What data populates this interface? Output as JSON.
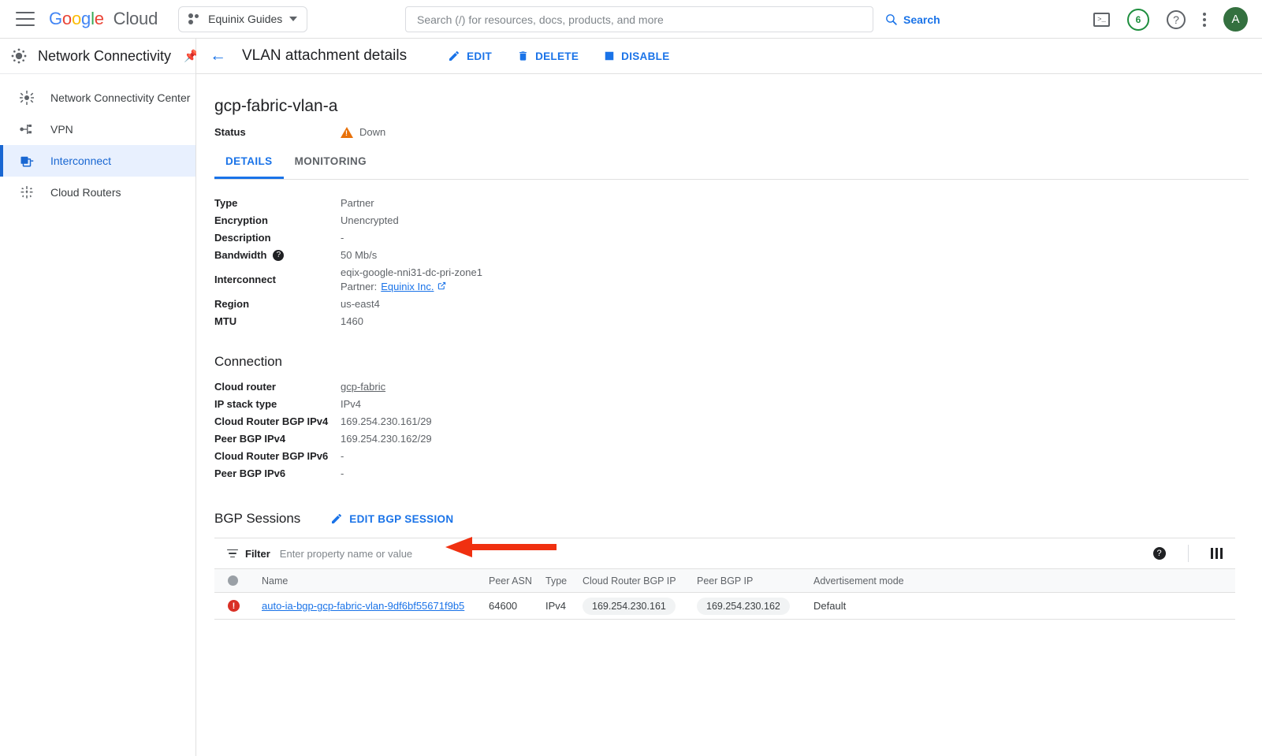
{
  "topbar": {
    "brand": "Google Cloud",
    "project_name": "Equinix Guides",
    "search_placeholder": "Search (/) for resources, docs, products, and more",
    "search_value": "",
    "search_button": "Search",
    "notification_count": "6",
    "avatar_initial": "A",
    "icons": {
      "menu": "hamburger-icon",
      "terminal": ">_",
      "help": "?",
      "kebab": "more-options-icon"
    }
  },
  "sidebar": {
    "title": "Network Connectivity",
    "items": [
      {
        "label": "Network Connectivity Center",
        "icon": "hub-icon",
        "active": false
      },
      {
        "label": "VPN",
        "icon": "vpn-icon",
        "active": false
      },
      {
        "label": "Interconnect",
        "icon": "interconnect-icon",
        "active": true
      },
      {
        "label": "Cloud Routers",
        "icon": "router-icon",
        "active": false
      }
    ]
  },
  "page": {
    "title": "VLAN attachment details",
    "actions": [
      {
        "label": "EDIT",
        "icon": "pencil-icon"
      },
      {
        "label": "DELETE",
        "icon": "trash-icon"
      },
      {
        "label": "DISABLE",
        "icon": "square-icon"
      }
    ],
    "resource_name": "gcp-fabric-vlan-a",
    "status_label": "Status",
    "status_value": "Down",
    "status_color": "#e8710a",
    "tabs": [
      {
        "label": "DETAILS",
        "active": true
      },
      {
        "label": "MONITORING",
        "active": false
      }
    ]
  },
  "details": {
    "rows": [
      {
        "key": "Type",
        "value": "Partner"
      },
      {
        "key": "Encryption",
        "value": "Unencrypted"
      },
      {
        "key": "Description",
        "value": "-"
      },
      {
        "key": "Bandwidth",
        "value": "50 Mb/s",
        "help": "?"
      },
      {
        "key": "Interconnect",
        "value": "eqix-google-nni31-dc-pri-zone1"
      },
      {
        "key": "Region",
        "value": "us-east4"
      },
      {
        "key": "MTU",
        "value": "1460"
      }
    ],
    "interconnect_partner_prefix": "Partner:",
    "interconnect_partner_link": "Equinix Inc."
  },
  "connection": {
    "heading": "Connection",
    "cloud_router_label": "Cloud router",
    "cloud_router_link": "gcp-fabric",
    "rows": [
      {
        "key": "IP stack type",
        "value": "IPv4"
      },
      {
        "key": "Cloud Router BGP IPv4",
        "value": "169.254.230.161/29"
      },
      {
        "key": "Peer BGP IPv4",
        "value": "169.254.230.162/29"
      },
      {
        "key": "Cloud Router BGP IPv6",
        "value": "-"
      },
      {
        "key": "Peer BGP IPv6",
        "value": "-"
      }
    ]
  },
  "bgp_sessions": {
    "heading": "BGP Sessions",
    "edit_button": "EDIT BGP SESSION",
    "filter_label": "Filter",
    "filter_placeholder": "Enter property name or value",
    "filter_value": "",
    "columns": [
      "",
      "Name",
      "Peer ASN",
      "Type",
      "Cloud Router BGP IP",
      "Peer BGP IP",
      "Advertisement mode"
    ],
    "rows": [
      {
        "status": "error",
        "name": "auto-ia-bgp-gcp-fabric-vlan-9df6bf55671f9b5",
        "peer_asn": "64600",
        "type": "IPv4",
        "cloud_router_bgp_ip": "169.254.230.161",
        "peer_bgp_ip": "169.254.230.162",
        "advertisement_mode": "Default"
      }
    ]
  },
  "annotation": {
    "arrow_color": "#f03010",
    "points_to": "EDIT BGP SESSION"
  }
}
